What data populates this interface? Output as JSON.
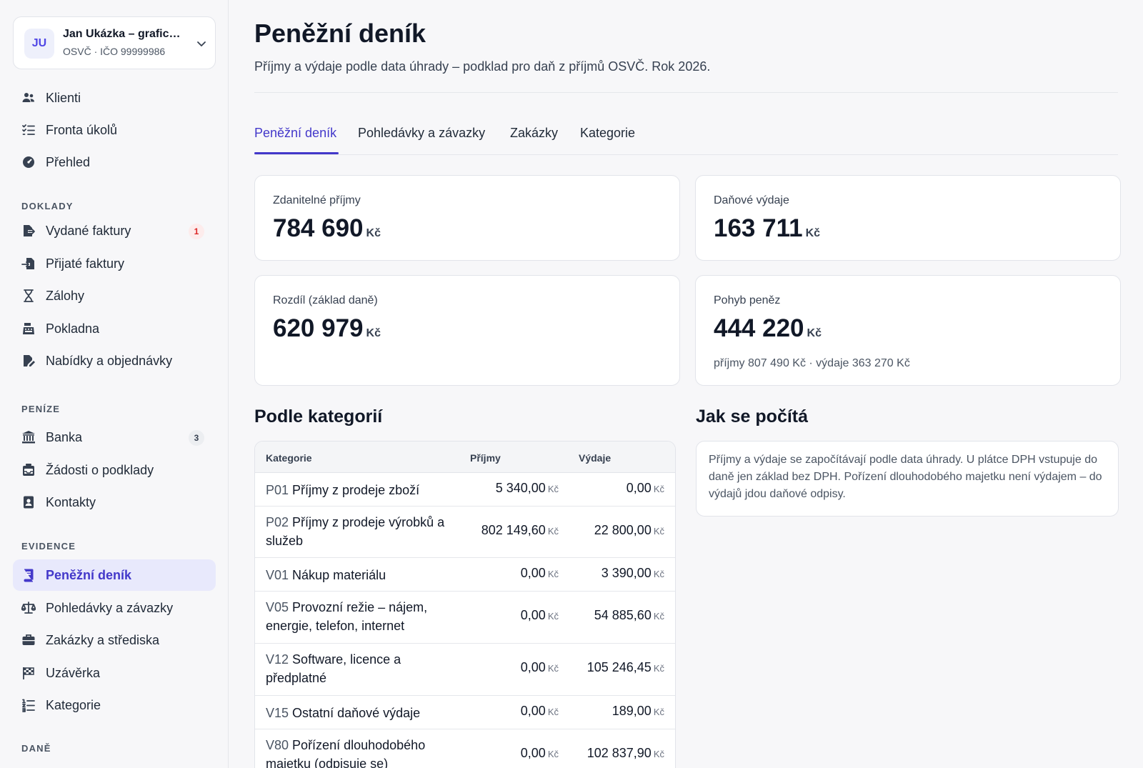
{
  "account": {
    "initials": "JU",
    "name": "Jan Ukázka – grafic…",
    "sub": "OSVČ · IČO 99999986"
  },
  "sidebar": {
    "top_items": [
      {
        "label": "Klienti",
        "icon": "users-icon"
      },
      {
        "label": "Fronta úkolů",
        "icon": "task-list-icon"
      },
      {
        "label": "Přehled",
        "icon": "dashboard-gauge-icon"
      }
    ],
    "sections": [
      {
        "title": "DOKLADY",
        "items": [
          {
            "label": "Vydané faktury",
            "icon": "invoice-out-icon",
            "badge": "1"
          },
          {
            "label": "Přijaté faktury",
            "icon": "invoice-in-icon"
          },
          {
            "label": "Zálohy",
            "icon": "hourglass-icon"
          },
          {
            "label": "Pokladna",
            "icon": "cash-register-icon"
          },
          {
            "label": "Nabídky a objednávky",
            "icon": "document-edit-icon"
          }
        ]
      },
      {
        "title": "PENÍZE",
        "items": [
          {
            "label": "Banka",
            "icon": "bank-icon",
            "badge": "3"
          },
          {
            "label": "Žádosti o podklady",
            "icon": "inbox-request-icon"
          },
          {
            "label": "Kontakty",
            "icon": "contact-card-icon"
          }
        ]
      },
      {
        "title": "EVIDENCE",
        "items": [
          {
            "label": "Peněžní deník",
            "icon": "book-icon",
            "active": true
          },
          {
            "label": "Pohledávky a závazky",
            "icon": "scale-icon"
          },
          {
            "label": "Zakázky a střediska",
            "icon": "briefcase-icon"
          },
          {
            "label": "Uzávěrka",
            "icon": "checkered-flag-icon"
          },
          {
            "label": "Kategorie",
            "icon": "numbered-list-icon"
          }
        ]
      },
      {
        "title": "DANĚ",
        "items": []
      }
    ]
  },
  "page": {
    "title": "Peněžní deník",
    "subtitle": "Příjmy a výdaje podle data úhrady – podklad pro daň z příjmů OSVČ. Rok 2026."
  },
  "tabs": [
    "Peněžní deník",
    "Pohledávky a závazky",
    "Zakázky",
    "Kategorie"
  ],
  "active_tab": "Peněžní deník",
  "cards": {
    "taxable_income": {
      "label": "Zdanitelné příjmy",
      "value": "784 690",
      "unit": "Kč"
    },
    "tax_expenses": {
      "label": "Daňové výdaje",
      "value": "163 711",
      "unit": "Kč"
    },
    "difference": {
      "label": "Rozdíl (základ daně)",
      "value": "620 979",
      "unit": "Kč"
    },
    "cash_flow": {
      "label": "Pohyb peněz",
      "value": "444 220",
      "unit": "Kč",
      "note": "příjmy 807 490 Kč · výdaje 363 270 Kč"
    }
  },
  "by_category": {
    "title": "Podle kategorií",
    "headers": {
      "category": "Kategorie",
      "income": "Příjmy",
      "expenses": "Výdaje"
    },
    "unit": "Kč",
    "rows": [
      {
        "code": "P01",
        "name": "Příjmy z prodeje zboží",
        "income": "5 340,00",
        "expenses": "0,00"
      },
      {
        "code": "P02",
        "name": "Příjmy z prodeje výrobků a služeb",
        "income": "802 149,60",
        "expenses": "22 800,00"
      },
      {
        "code": "V01",
        "name": "Nákup materiálu",
        "income": "0,00",
        "expenses": "3 390,00"
      },
      {
        "code": "V05",
        "name": "Provozní režie – nájem, energie, telefon, internet",
        "income": "0,00",
        "expenses": "54 885,60"
      },
      {
        "code": "V12",
        "name": "Software, licence a předplatné",
        "income": "0,00",
        "expenses": "105 246,45"
      },
      {
        "code": "V15",
        "name": "Ostatní daňové výdaje",
        "income": "0,00",
        "expenses": "189,00"
      },
      {
        "code": "V80",
        "name": "Pořízení dlouhodobého majetku (odpisuje se)",
        "income": "0,00",
        "expenses": "102 837,90"
      }
    ]
  },
  "how": {
    "title": "Jak se počítá",
    "text": "Příjmy a výdaje se započítávají podle data úhrady. U plátce DPH vstupuje do daně jen základ bez DPH. Pořízení dlouhodobého majetku není výdajem – do výdajů jdou daňové odpisy."
  }
}
